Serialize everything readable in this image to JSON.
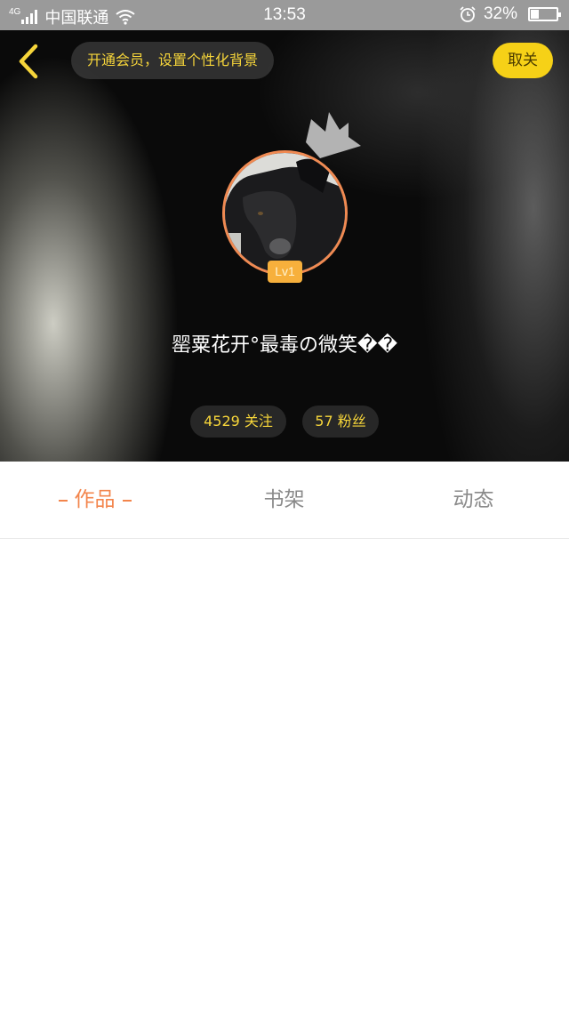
{
  "status_bar": {
    "network_type": "4G",
    "carrier": "中国联通",
    "time": "13:53",
    "battery_percent": "32%",
    "battery_level": 0.32
  },
  "header": {
    "vip_promo": "开通会员，设置个性化背景",
    "unfollow_label": "取关",
    "level_badge": "Lv1",
    "nickname": "罂粟花开°最毒の微笑��",
    "following_count": "4529 关注",
    "fans_count": "57 粉丝"
  },
  "tabs": [
    {
      "label": "作品",
      "active": true
    },
    {
      "label": "书架",
      "active": false
    },
    {
      "label": "动态",
      "active": false
    }
  ],
  "colors": {
    "accent_orange": "#f3854c",
    "accent_yellow": "#f6d117",
    "tab_inactive": "#8a8a8a"
  },
  "icons": [
    "back-arrow-icon",
    "signal-icon",
    "wifi-icon",
    "alarm-icon",
    "battery-icon",
    "crown-icon"
  ]
}
